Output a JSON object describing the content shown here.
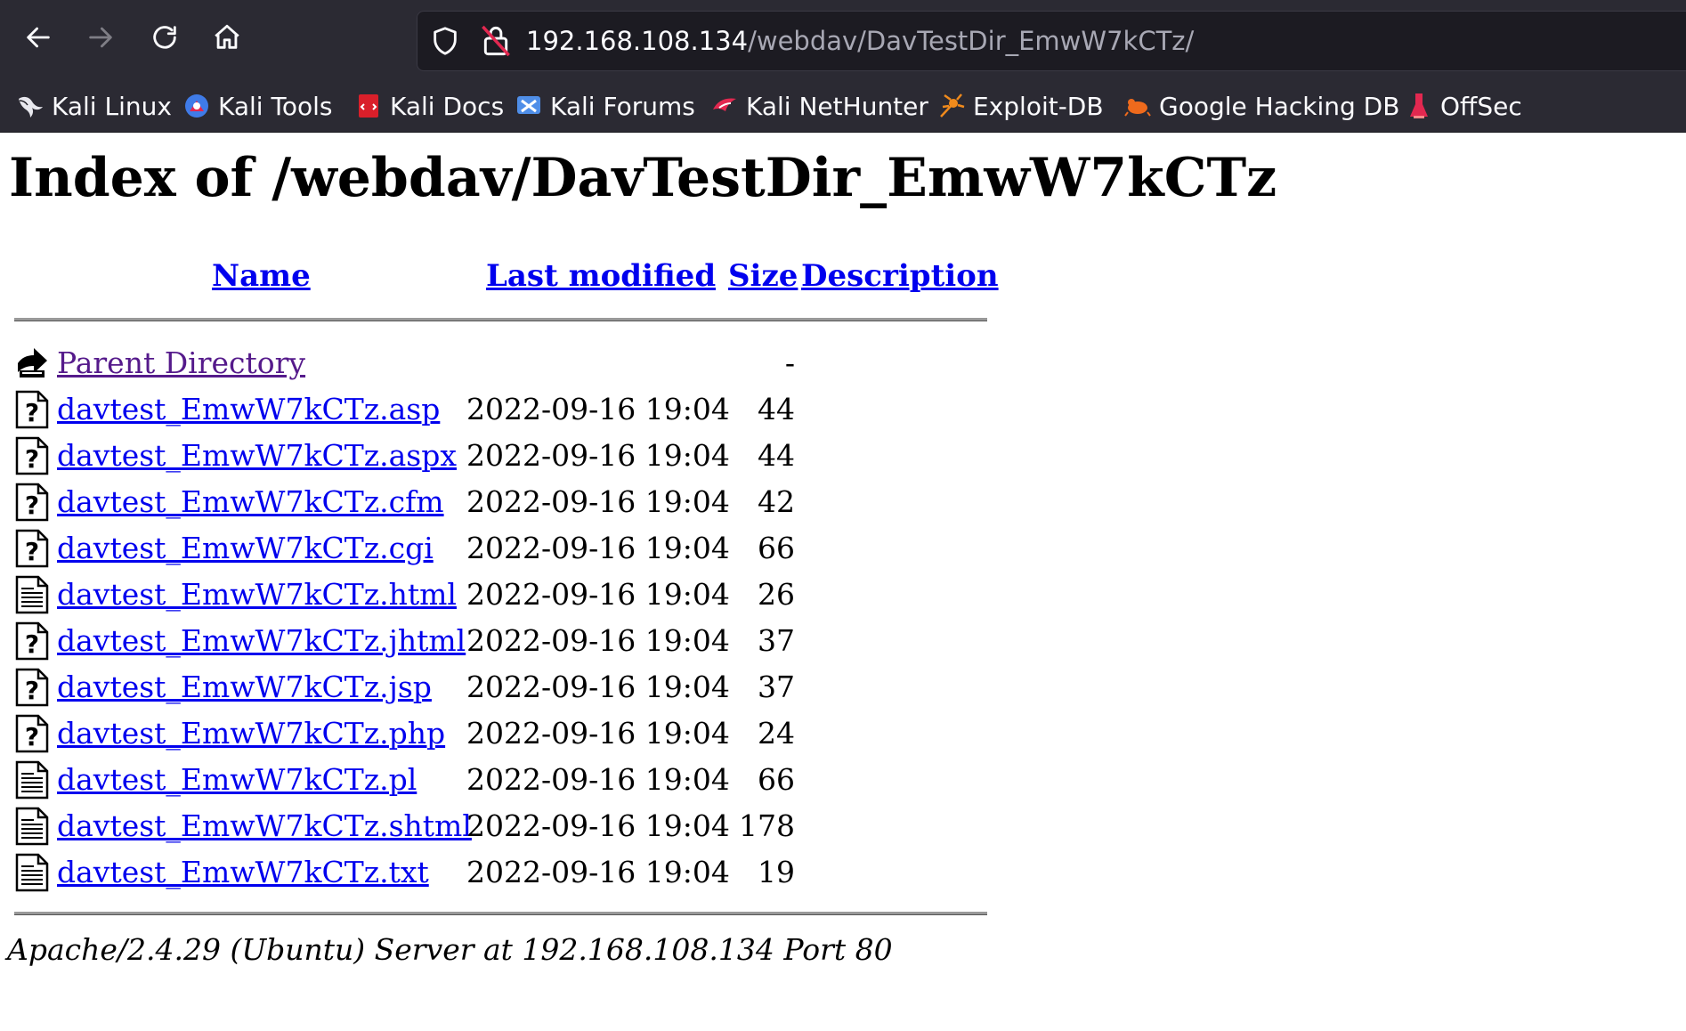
{
  "browser": {
    "nav": {
      "back_icon": "arrow-left-icon",
      "forward_icon": "arrow-right-icon",
      "reload_icon": "reload-icon",
      "home_icon": "home-icon"
    },
    "url": {
      "host": "192.168.108.134",
      "path": "/webdav/DavTestDir_EmwW7kCTz/"
    },
    "bookmarks": [
      {
        "label": "Kali Linux",
        "icon": "kali-dragon-icon"
      },
      {
        "label": "Kali Tools",
        "icon": "kali-tools-icon"
      },
      {
        "label": "Kali Docs",
        "icon": "kali-docs-icon"
      },
      {
        "label": "Kali Forums",
        "icon": "kali-forums-icon"
      },
      {
        "label": "Kali NetHunter",
        "icon": "kali-nethunter-icon"
      },
      {
        "label": "Exploit-DB",
        "icon": "exploit-db-icon"
      },
      {
        "label": "Google Hacking DB",
        "icon": "ghdb-icon"
      },
      {
        "label": "OffSec",
        "icon": "offsec-icon"
      }
    ]
  },
  "page": {
    "title": "Index of /webdav/DavTestDir_EmwW7kCTz",
    "columns": {
      "name": "Name",
      "last_modified": "Last modified",
      "size": "Size",
      "description": "Description"
    },
    "parent": {
      "name": "Parent Directory",
      "size": "-",
      "icon": "back-folder-icon"
    },
    "files": [
      {
        "name": "davtest_EmwW7kCTz.asp",
        "modified": "2022-09-16 19:04",
        "size": "44",
        "icon": "unknown-file-icon"
      },
      {
        "name": "davtest_EmwW7kCTz.aspx",
        "modified": "2022-09-16 19:04",
        "size": "44",
        "icon": "unknown-file-icon"
      },
      {
        "name": "davtest_EmwW7kCTz.cfm",
        "modified": "2022-09-16 19:04",
        "size": "42",
        "icon": "unknown-file-icon"
      },
      {
        "name": "davtest_EmwW7kCTz.cgi",
        "modified": "2022-09-16 19:04",
        "size": "66",
        "icon": "unknown-file-icon"
      },
      {
        "name": "davtest_EmwW7kCTz.html",
        "modified": "2022-09-16 19:04",
        "size": "26",
        "icon": "text-file-icon"
      },
      {
        "name": "davtest_EmwW7kCTz.jhtml",
        "modified": "2022-09-16 19:04",
        "size": "37",
        "icon": "unknown-file-icon"
      },
      {
        "name": "davtest_EmwW7kCTz.jsp",
        "modified": "2022-09-16 19:04",
        "size": "37",
        "icon": "unknown-file-icon"
      },
      {
        "name": "davtest_EmwW7kCTz.php",
        "modified": "2022-09-16 19:04",
        "size": "24",
        "icon": "unknown-file-icon"
      },
      {
        "name": "davtest_EmwW7kCTz.pl",
        "modified": "2022-09-16 19:04",
        "size": "66",
        "icon": "text-file-icon"
      },
      {
        "name": "davtest_EmwW7kCTz.shtml",
        "modified": "2022-09-16 19:04",
        "size": "178",
        "icon": "text-file-icon"
      },
      {
        "name": "davtest_EmwW7kCTz.txt",
        "modified": "2022-09-16 19:04",
        "size": "19",
        "icon": "text-file-icon"
      }
    ],
    "footer": "Apache/2.4.29 (Ubuntu) Server at 192.168.108.134 Port 80"
  }
}
